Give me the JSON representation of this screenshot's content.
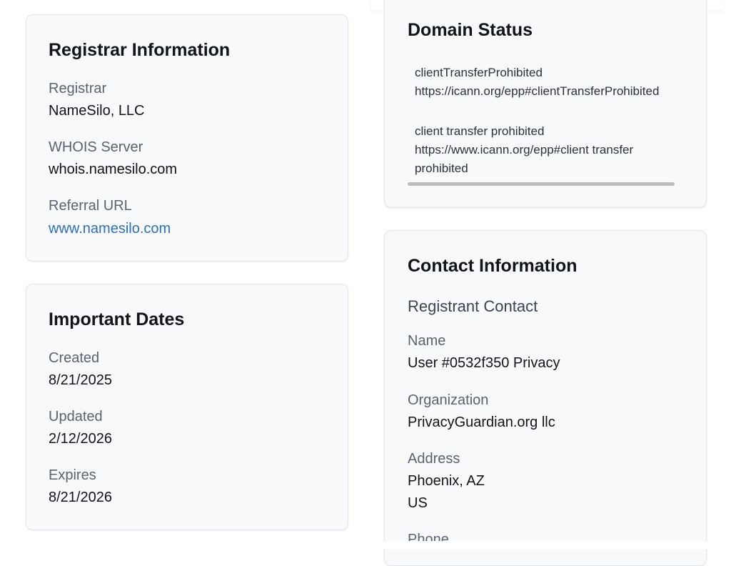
{
  "registrar_card": {
    "title": "Registrar Information",
    "registrar_label": "Registrar",
    "registrar_value": "NameSilo, LLC",
    "whois_label": "WHOIS Server",
    "whois_value": "whois.namesilo.com",
    "referral_label": "Referral URL",
    "referral_value": "www.namesilo.com"
  },
  "dates_card": {
    "title": "Important Dates",
    "created_label": "Created",
    "created_value": "8/21/2025",
    "updated_label": "Updated",
    "updated_value": "2/12/2026",
    "expires_label": "Expires",
    "expires_value": "8/21/2026"
  },
  "status_card": {
    "title": "Domain Status",
    "statuses": [
      {
        "code": "clientTransferProhibited",
        "url": "https://icann.org/epp#clientTransferProhibited"
      },
      {
        "code": "client transfer prohibited",
        "url_line1": "https://www.icann.org/epp#client transfer",
        "url_line2": "prohibited"
      }
    ]
  },
  "contact_card": {
    "title": "Contact Information",
    "section": "Registrant Contact",
    "name_label": "Name",
    "name_value": "User #0532f350 Privacy",
    "org_label": "Organization",
    "org_value": "PrivacyGuardian.org llc",
    "address_label": "Address",
    "address_line1": "Phoenix, AZ",
    "address_line2": "US",
    "phone_label": "Phone"
  },
  "colors": {
    "link": "#2f6fb7",
    "card_bg": "#f8f9fb",
    "label": "#5a6370"
  }
}
